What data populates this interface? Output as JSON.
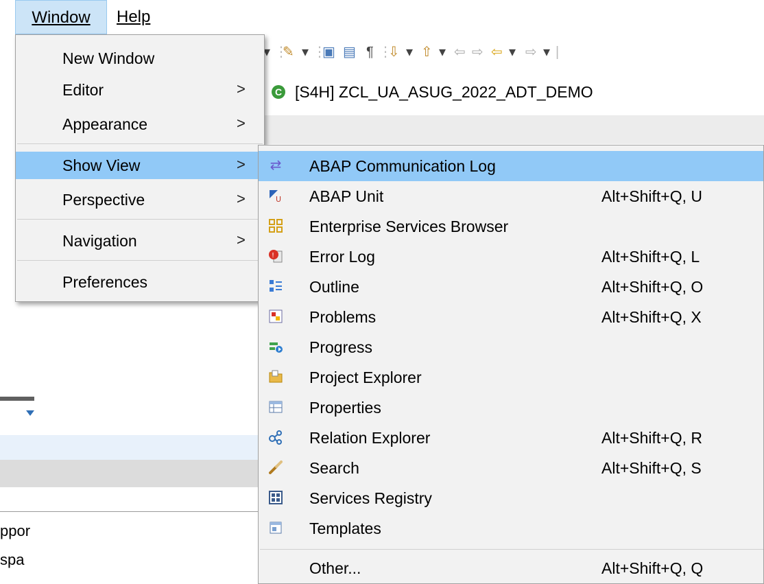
{
  "menubar": {
    "window_label": "Window",
    "help_label": "Help"
  },
  "editor": {
    "tab_title": "[S4H] ZCL_UA_ASUG_2022_ADT_DEMO"
  },
  "left_panel": {
    "text1": "ppor",
    "text2": "spa"
  },
  "window_menu": {
    "items": [
      {
        "label": "New Window",
        "has_submenu": false
      },
      {
        "label": "Editor",
        "has_submenu": true
      },
      {
        "label": "Appearance",
        "has_submenu": true
      },
      {
        "label": "Show View",
        "has_submenu": true,
        "selected": true
      },
      {
        "label": "Perspective",
        "has_submenu": true
      },
      {
        "label": "Navigation",
        "has_submenu": true
      },
      {
        "label": "Preferences",
        "has_submenu": false
      }
    ],
    "arrow": ">"
  },
  "show_view_menu": {
    "items": [
      {
        "label": "ABAP Communication Log",
        "accel": "",
        "icon": "communication-log-icon",
        "selected": true
      },
      {
        "label": "ABAP Unit",
        "accel": "Alt+Shift+Q, U",
        "icon": "abap-unit-icon"
      },
      {
        "label": "Enterprise Services Browser",
        "accel": "",
        "icon": "services-browser-icon"
      },
      {
        "label": "Error Log",
        "accel": "Alt+Shift+Q, L",
        "icon": "error-log-icon"
      },
      {
        "label": "Outline",
        "accel": "Alt+Shift+Q, O",
        "icon": "outline-icon"
      },
      {
        "label": "Problems",
        "accel": "Alt+Shift+Q, X",
        "icon": "problems-icon"
      },
      {
        "label": "Progress",
        "accel": "",
        "icon": "progress-icon"
      },
      {
        "label": "Project Explorer",
        "accel": "",
        "icon": "project-explorer-icon"
      },
      {
        "label": "Properties",
        "accel": "",
        "icon": "properties-icon"
      },
      {
        "label": "Relation Explorer",
        "accel": "Alt+Shift+Q, R",
        "icon": "relation-explorer-icon"
      },
      {
        "label": "Search",
        "accel": "Alt+Shift+Q, S",
        "icon": "search-icon"
      },
      {
        "label": "Services Registry",
        "accel": "",
        "icon": "services-registry-icon"
      },
      {
        "label": "Templates",
        "accel": "",
        "icon": "templates-icon"
      },
      {
        "label": "Other...",
        "accel": "Alt+Shift+Q, Q",
        "icon": ""
      }
    ]
  },
  "colors": {
    "menu_bg": "#f2f2f2",
    "selection": "#91c9f7",
    "menubar_highlight": "#cce4f7"
  }
}
